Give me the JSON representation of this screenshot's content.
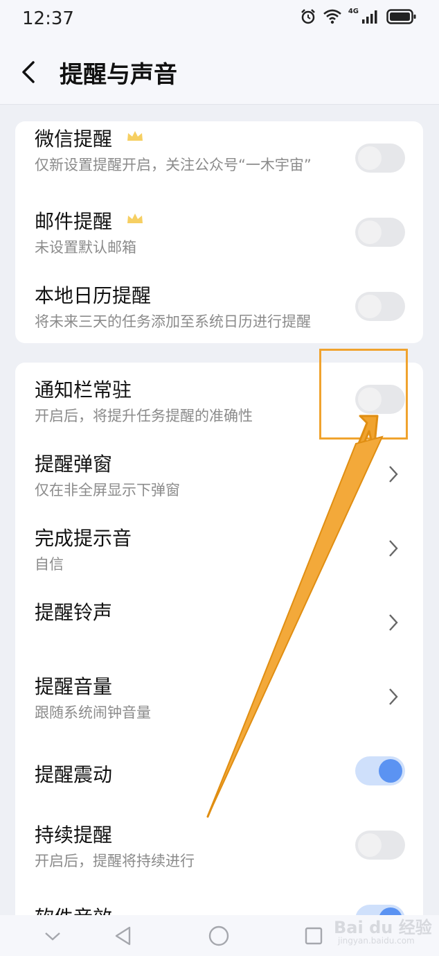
{
  "status": {
    "time": "12:37",
    "network": "4G"
  },
  "header": {
    "title": "提醒与声音"
  },
  "group1": [
    {
      "title": "微信提醒",
      "vip": true,
      "subtitle": "仅新设置提醒开启，关注公众号“一木宇宙”",
      "switch": "off"
    },
    {
      "title": "邮件提醒",
      "vip": true,
      "subtitle": "未设置默认邮箱",
      "switch": "off"
    },
    {
      "title": "本地日历提醒",
      "subtitle": "将未来三天的任务添加至系统日历进行提醒",
      "switch": "off"
    }
  ],
  "group2": [
    {
      "title": "通知栏常驻",
      "subtitle": "开启后，将提升任务提醒的准确性",
      "control": "switch",
      "switch": "off"
    },
    {
      "title": "提醒弹窗",
      "subtitle": "仅在非全屏显示下弹窗",
      "control": "chevron"
    },
    {
      "title": "完成提示音",
      "subtitle": "自信",
      "control": "chevron"
    },
    {
      "title": "提醒铃声",
      "subtitle": "",
      "control": "chevron"
    },
    {
      "title": "提醒音量",
      "subtitle": "跟随系统闹钟音量",
      "control": "chevron"
    },
    {
      "title": "提醒震动",
      "subtitle": "",
      "control": "switch",
      "switch": "on"
    },
    {
      "title": "持续提醒",
      "subtitle": "开启后，提醒将持续进行",
      "control": "switch",
      "switch": "off"
    },
    {
      "title": "软件音效",
      "subtitle": "",
      "control": "switch",
      "switch": "on"
    }
  ],
  "watermark": {
    "brand": "Bai du 经验",
    "url": "jingyan.baidu.com"
  },
  "colors": {
    "accent": "#5b93f2",
    "annotation": "#f0a32e",
    "background": "#eef0f5"
  }
}
